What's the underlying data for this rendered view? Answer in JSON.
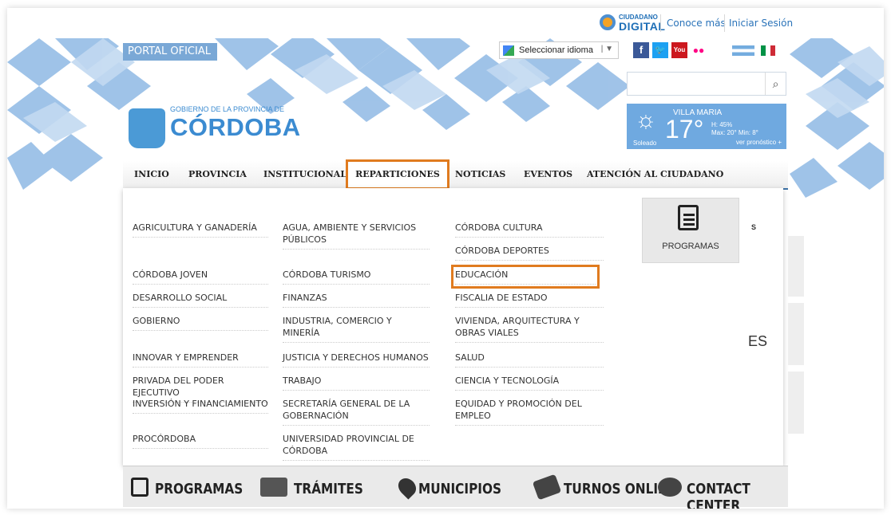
{
  "topbar": {
    "brand_small": "CIUDADANO",
    "brand_big": "DIGITAL",
    "conoce": "Conoce más",
    "login": "Iniciar Sesión"
  },
  "header": {
    "portal": "PORTAL OFICIAL",
    "language": "Seleccionar idioma",
    "logo_small": "GOBIERNO DE LA PROVINCIA DE",
    "logo_big": "CÓRDOBA",
    "social": [
      "f",
      "t",
      "You",
      "••"
    ]
  },
  "weather": {
    "city": "VILLA MARIA",
    "temp": "17°",
    "humidity": "H: 45%",
    "minmax": "Max: 20° Min: 8°",
    "condition": "Soleado",
    "forecast_link": "ver pronóstico +"
  },
  "nav": [
    "INICIO",
    "PROVINCIA",
    "INSTITUCIONAL",
    "REPARTICIONES",
    "NOTICIAS",
    "EVENTOS",
    "ATENCIÓN AL CIUDADANO"
  ],
  "dropdown": {
    "col1": [
      "AGRICULTURA Y GANADERÍA",
      "CÓRDOBA JOVEN",
      "DESARROLLO SOCIAL",
      "GOBIERNO",
      "INNOVAR Y EMPRENDER",
      "PRIVADA DEL PODER EJECUTIVO",
      "INVERSIÓN Y FINANCIAMIENTO",
      "PROCÓRDOBA"
    ],
    "col2": [
      "AGUA, AMBIENTE Y SERVICIOS PÚBLICOS",
      "CÓRDOBA TURISMO",
      "FINANZAS",
      "INDUSTRIA, COMERCIO Y MINERÍA",
      "JUSTICIA Y DERECHOS HUMANOS",
      "TRABAJO",
      "SECRETARÍA GENERAL DE LA GOBERNACIÓN",
      "UNIVERSIDAD PROVINCIAL DE CÓRDOBA"
    ],
    "col3": [
      "CÓRDOBA CULTURA",
      "CÓRDOBA DEPORTES",
      "EDUCACIÓN",
      "FISCALIA DE ESTADO",
      "VIVIENDA, ARQUITECTURA Y OBRAS VIALES",
      "SALUD",
      "CIENCIA Y TECNOLOGÍA",
      "EQUIDAD Y PROMOCIÓN DEL EMPLEO"
    ],
    "programas": "PROGRAMAS"
  },
  "side": {
    "top": "S",
    "mid": "ES"
  },
  "bottom": [
    "PROGRAMAS",
    "TRÁMITES",
    "MUNICIPIOS",
    "TURNOS ONLINE",
    "CONTACT CENTER"
  ],
  "colors": {
    "accent": "#e07b1f",
    "nav_line": "#3c72a6",
    "brand_blue": "#3b8bd1"
  }
}
